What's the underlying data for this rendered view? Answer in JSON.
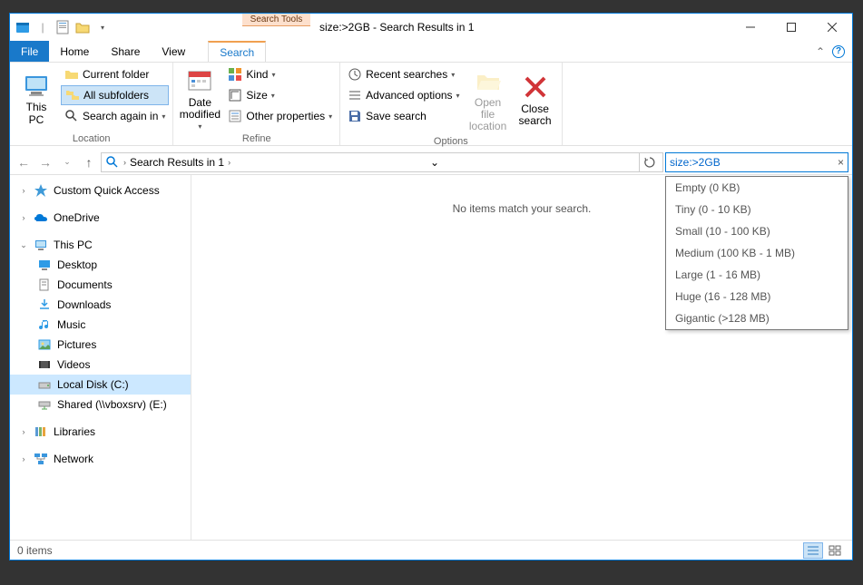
{
  "title": "size:>2GB - Search Results in 1",
  "tool_tab": "Search Tools",
  "tabs": {
    "file": "File",
    "home": "Home",
    "share": "Share",
    "view": "View",
    "search": "Search"
  },
  "ribbon": {
    "location": {
      "label": "Location",
      "this_pc": "This\nPC",
      "current_folder": "Current folder",
      "all_subfolders": "All subfolders",
      "search_again": "Search again in"
    },
    "refine": {
      "label": "Refine",
      "date_modified": "Date\nmodified",
      "kind": "Kind",
      "size": "Size",
      "other_properties": "Other properties"
    },
    "options": {
      "label": "Options",
      "recent_searches": "Recent searches",
      "advanced_options": "Advanced options",
      "save_search": "Save search",
      "open_file_location": "Open file\nlocation",
      "close_search": "Close\nsearch"
    }
  },
  "breadcrumb": "Search Results in 1",
  "search_query": "size:>2GB",
  "size_filters": [
    "Empty (0 KB)",
    "Tiny (0 - 10 KB)",
    "Small (10 - 100 KB)",
    "Medium (100 KB - 1 MB)",
    "Large (1 - 16 MB)",
    "Huge (16 - 128 MB)",
    "Gigantic (>128 MB)"
  ],
  "tree": {
    "quick_access": "Custom Quick Access",
    "onedrive": "OneDrive",
    "this_pc": "This PC",
    "desktop": "Desktop",
    "documents": "Documents",
    "downloads": "Downloads",
    "music": "Music",
    "pictures": "Pictures",
    "videos": "Videos",
    "local_disk": "Local Disk (C:)",
    "shared": "Shared (\\\\vboxsrv) (E:)",
    "libraries": "Libraries",
    "network": "Network"
  },
  "empty_msg": "No items match your search.",
  "status": "0 items"
}
